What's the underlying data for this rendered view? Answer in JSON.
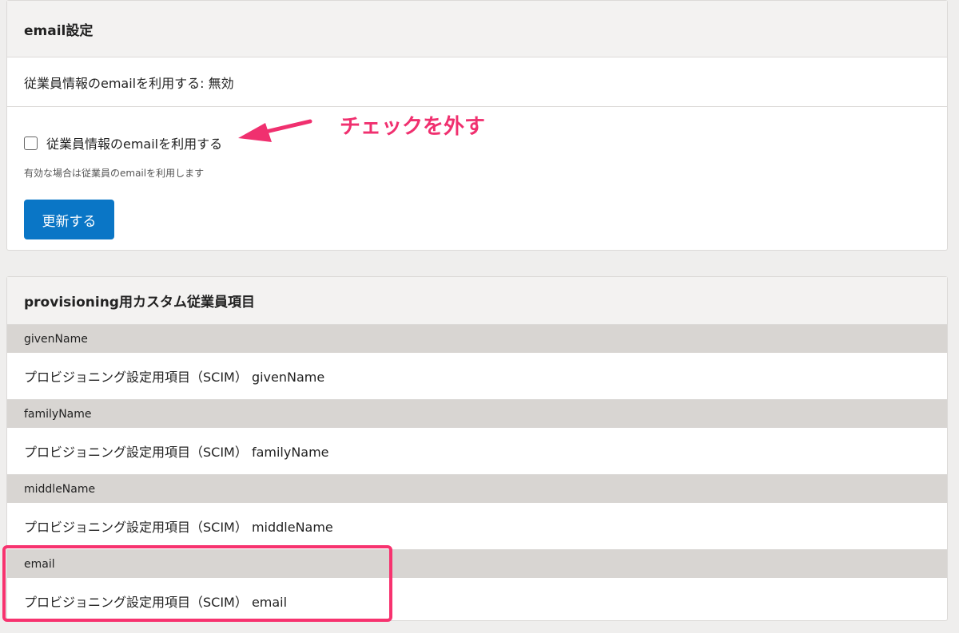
{
  "email_settings": {
    "title": "email設定",
    "status": "従業員情報のemailを利用する: 無効",
    "checkbox_label": "従業員情報のemailを利用する",
    "checked": false,
    "hint": "有効な場合は従業員のemailを利用します",
    "update_button": "更新する"
  },
  "provisioning": {
    "title": "provisioning用カスタム従業員項目",
    "items": [
      {
        "label": "givenName",
        "value": "プロビジョニング設定用項目（SCIM） givenName"
      },
      {
        "label": "familyName",
        "value": "プロビジョニング設定用項目（SCIM） familyName"
      },
      {
        "label": "middleName",
        "value": "プロビジョニング設定用項目（SCIM） middleName"
      },
      {
        "label": "email",
        "value": "プロビジョニング設定用項目（SCIM） email"
      }
    ]
  },
  "annotation": {
    "text": "チェックを外す",
    "color": "#f0306f"
  }
}
